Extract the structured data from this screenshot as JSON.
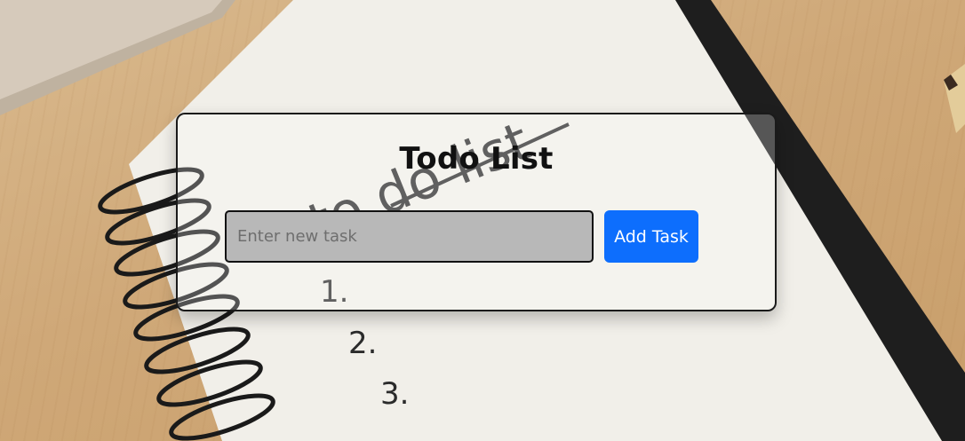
{
  "app": {
    "title": "Todo List"
  },
  "form": {
    "input_value": "",
    "input_placeholder": "Enter new task",
    "add_button_label": "Add Task"
  },
  "background": {
    "notebook_heading": "to do list",
    "notebook_items": [
      "1.",
      "2.",
      "3."
    ]
  },
  "colors": {
    "accent": "#0d6efd",
    "input_bg": "#b8b8b8",
    "card_border": "#1a1a1a"
  }
}
